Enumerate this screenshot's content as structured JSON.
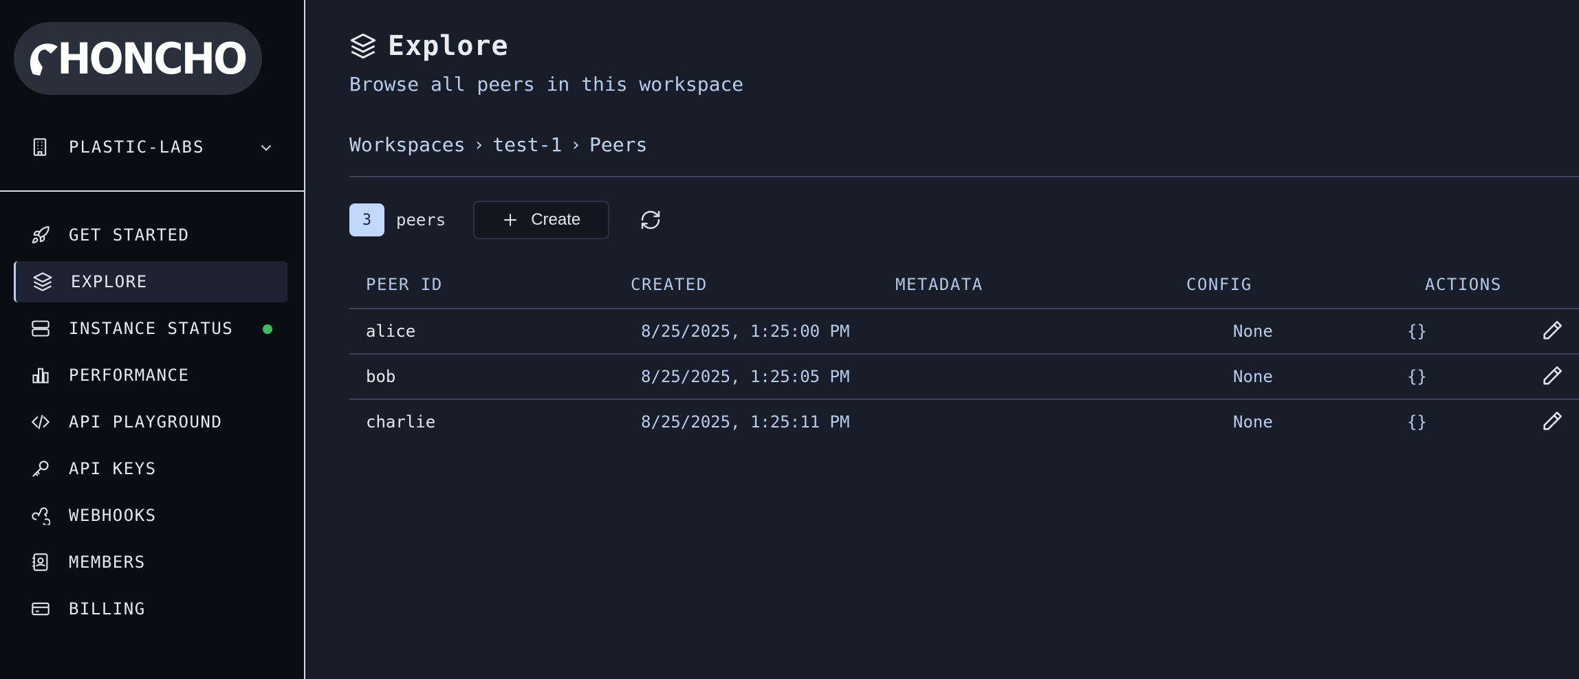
{
  "brand": {
    "logo_text": "HONCHO"
  },
  "workspace": {
    "name": "PLASTIC-LABS"
  },
  "nav": {
    "items": [
      {
        "label": "GET STARTED",
        "icon": "rocket-icon"
      },
      {
        "label": "EXPLORE",
        "icon": "layers-icon",
        "active": true
      },
      {
        "label": "INSTANCE STATUS",
        "icon": "server-icon",
        "status_color": "#3fba5f"
      },
      {
        "label": "PERFORMANCE",
        "icon": "bar-chart-icon"
      },
      {
        "label": "API PLAYGROUND",
        "icon": "code-icon"
      },
      {
        "label": "API KEYS",
        "icon": "key-icon"
      },
      {
        "label": "WEBHOOKS",
        "icon": "webhook-icon"
      },
      {
        "label": "MEMBERS",
        "icon": "contacts-icon"
      },
      {
        "label": "BILLING",
        "icon": "credit-card-icon"
      }
    ]
  },
  "page": {
    "title": "Explore",
    "subtitle": "Browse all peers in this workspace"
  },
  "breadcrumb": [
    "Workspaces",
    "test-1",
    "Peers"
  ],
  "toolbar": {
    "count": "3",
    "count_label": "peers",
    "create_label": "Create"
  },
  "table": {
    "columns": [
      "PEER ID",
      "CREATED",
      "METADATA",
      "CONFIG",
      "ACTIONS"
    ],
    "rows": [
      {
        "peer_id": "alice",
        "created": "8/25/2025, 1:25:00 PM",
        "metadata": "None",
        "config": "{}"
      },
      {
        "peer_id": "bob",
        "created": "8/25/2025, 1:25:05 PM",
        "metadata": "None",
        "config": "{}"
      },
      {
        "peer_id": "charlie",
        "created": "8/25/2025, 1:25:11 PM",
        "metadata": "None",
        "config": "{}"
      }
    ]
  },
  "colors": {
    "accent": "#c3d9fb",
    "status_online": "#3fba5f",
    "background": "#181e29",
    "sidebar": "#0b0d15"
  }
}
